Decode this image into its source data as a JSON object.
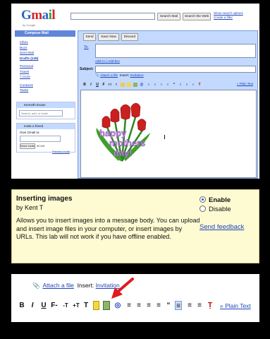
{
  "gmail": {
    "logo": "Gmail",
    "logo_sub": "by Google",
    "search_mail": "Search Mail",
    "search_web": "Search the Web",
    "search_options": "Show search options",
    "create_filter": "Create a filter",
    "compose_mail": "Compose Mail",
    "nav": [
      "Inbox",
      "Buzz",
      "Sent Mail",
      "Drafts (139)",
      "Personal",
      "Travel",
      "7 more",
      "Contacts",
      "Tasks"
    ],
    "chat_user": "Kenneth Evans",
    "chat_search_placeholder": "Search, add, or invite",
    "invite_title": "Invite a friend",
    "invite_text": "Give Gmail to:",
    "send_invite": "Send Invite",
    "invites_left": "50 left",
    "preview_invite": "Preview Invite",
    "send": "Send",
    "save_now": "Save Now",
    "discard": "Discard",
    "to_label": "To:",
    "add_cc": "Add Cc",
    "add_bcc": "Add Bcc",
    "subject_label": "Subject:",
    "attach_file": "Attach a file",
    "insert_label": "Insert:",
    "invitation": "Invitation",
    "plain_text": "« Plain Text",
    "image_text": [
      "happy",
      "mothers",
      "day!"
    ]
  },
  "lab": {
    "title": "Inserting images",
    "author": "by Kent T",
    "description": "Allows you to insert images into a message body. You can upload and insert image files in your computer, or insert images by URLs. This lab will not work if you have offline enabled.",
    "enable": "Enable",
    "disable": "Disable",
    "selected": "Enable",
    "send_feedback": "Send feedback"
  },
  "zoom": {
    "attach_file": "Attach a file",
    "insert_label": "Insert:",
    "invitation": "Invitation",
    "plain_text": "« Plain Text",
    "tools": [
      "B",
      "I",
      "U",
      "F",
      "-T",
      "+T",
      "T",
      "T",
      "img",
      "link",
      "ol",
      "ul",
      "outdent",
      "indent",
      "quote",
      "left",
      "center",
      "right",
      "Tx"
    ]
  },
  "colors": {
    "gmail_blue": "#c3d9ff",
    "compose_blue": "#5f86d9",
    "link": "#2044b8",
    "lab_bg": "#fefbd3",
    "arrow": "#e01b1b"
  }
}
